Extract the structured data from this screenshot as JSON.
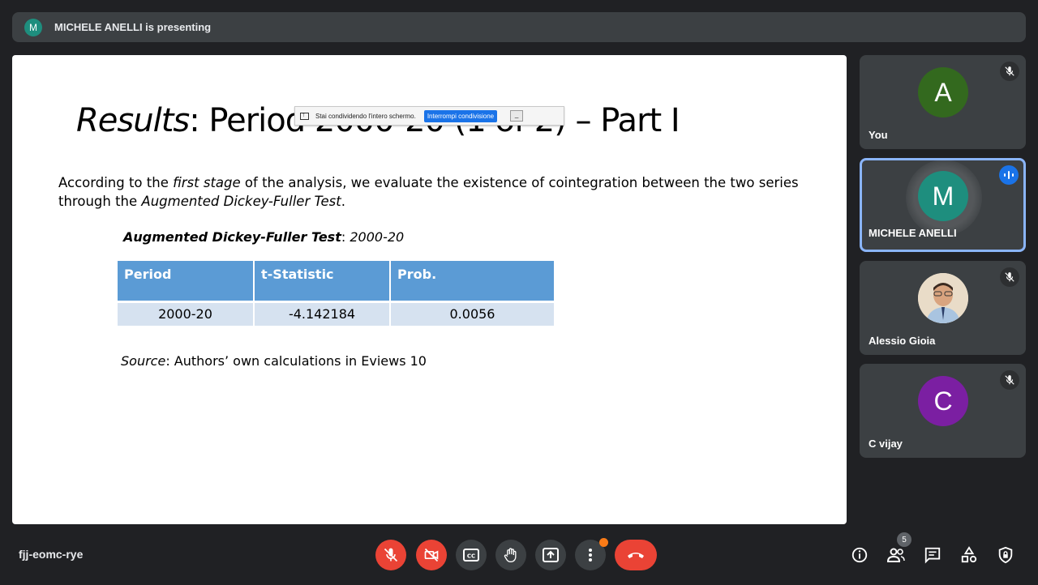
{
  "presenting_bar": {
    "avatar_letter": "M",
    "text": "MICHELE ANELLI is presenting"
  },
  "slide": {
    "title_italic": "Results",
    "title_rest": ": Period 2000-20 (1 of 2) – Part I",
    "paragraph": {
      "t1": "According to the ",
      "i1": "first stage",
      "t2": " of the analysis, we evaluate the existence of cointegration between the two series through the ",
      "i2": "Augmented Dickey-Fuller Test",
      "t3": "."
    },
    "table_caption_bold": "Augmented Dickey-Fuller Test",
    "table_caption_sep": ": ",
    "table_caption_period": "2000-20",
    "table": {
      "headers": [
        "Period",
        "t-Statistic",
        "Prob."
      ],
      "rows": [
        [
          "2000-20",
          "-4.142184",
          "0.0056"
        ]
      ]
    },
    "source_label": "Source",
    "source_text": ": Authors’ own calculations in Eviews 10"
  },
  "share_notice": {
    "text": "Stai condividendo l'intero schermo.",
    "stop_label": "Interrompi condivisione",
    "hide_label": "_"
  },
  "participants": [
    {
      "letter": "A",
      "name": "You",
      "color": "#33691e",
      "muted": true
    },
    {
      "letter": "M",
      "name": "MICHELE ANELLI",
      "color": "#1e8e7e",
      "speaking": true
    },
    {
      "letter": "",
      "name": "Alessio Gioia",
      "muted": true,
      "photo": true
    },
    {
      "letter": "C",
      "name": "C vijay",
      "color": "#7b1fa2",
      "muted": true
    }
  ],
  "meeting_code": "fjj-eomc-rye",
  "participant_count": "5",
  "controls": [
    "mic-off",
    "camera-off",
    "captions",
    "raise-hand",
    "present",
    "more",
    "leave-call"
  ],
  "right_controls": [
    "info",
    "people",
    "chat",
    "activities",
    "host-controls"
  ]
}
